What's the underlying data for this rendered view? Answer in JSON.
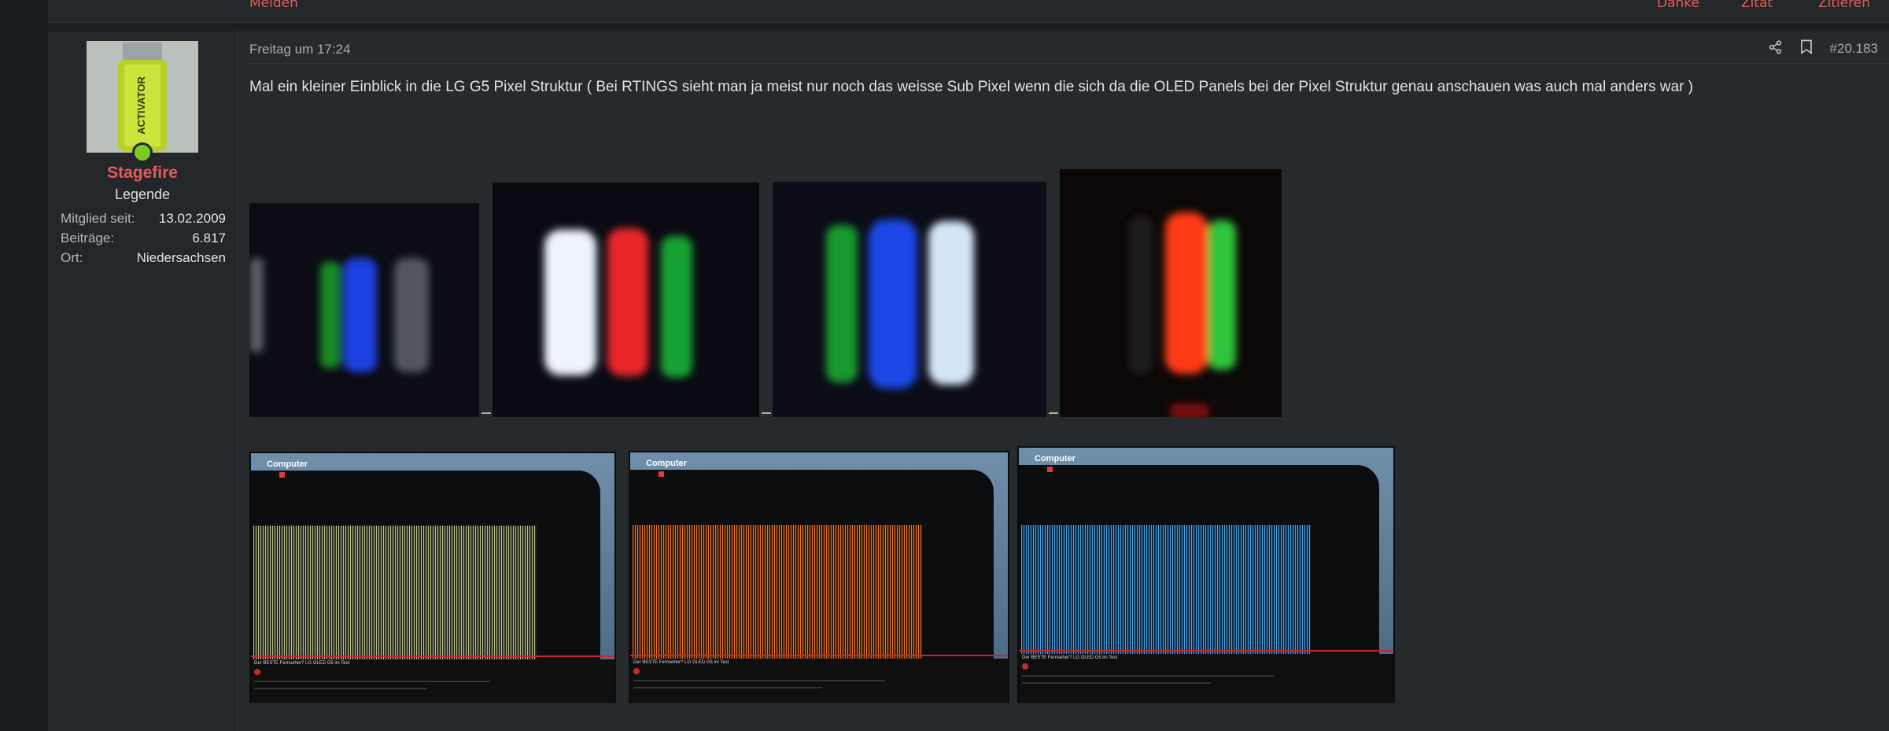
{
  "top_strip": {
    "left_fragment": "Melden",
    "right_fragments": [
      "Danke",
      "Zitat",
      "Zitieren"
    ]
  },
  "user": {
    "name": "Stagefire",
    "title": "Legende",
    "avatar_text": "ACTIVATOR",
    "stats": [
      {
        "label": "Mitglied seit:",
        "value": "13.02.2009"
      },
      {
        "label": "Beiträge:",
        "value": "6.817"
      },
      {
        "label": "Ort:",
        "value": "Niedersachsen"
      }
    ]
  },
  "post": {
    "date": "Freitag um 17:24",
    "number": "#20.183",
    "message": "Mal ein kleiner Einblick in die LG G5 Pixel Struktur ( Bei RTINGS sieht man ja meist nur noch das weisse Sub Pixel wenn die sich da die OLED Panels bei der Pixel Struktur genau anschauen was auch mal anders war )"
  },
  "screenshots": {
    "brand": "Computer",
    "video_title": "Der BESTE Fernseher? LG OLED G5 im Test"
  },
  "icons": {
    "share": "share-icon",
    "bookmark": "bookmark-icon"
  },
  "colors": {
    "accent": "#e65a5a",
    "online": "#7ccb22"
  }
}
